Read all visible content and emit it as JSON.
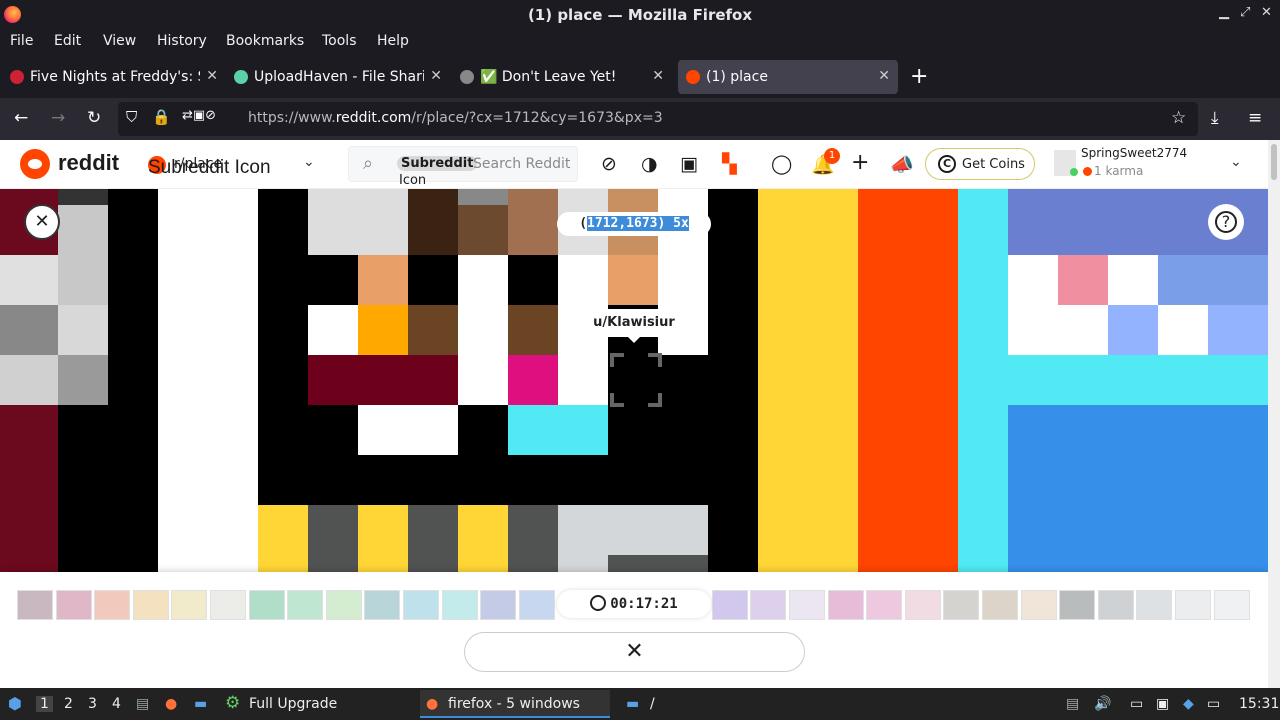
{
  "window": {
    "title": "(1) place — Mozilla Firefox"
  },
  "menu": [
    "File",
    "Edit",
    "View",
    "History",
    "Bookmarks",
    "Tools",
    "Help"
  ],
  "tabs": [
    {
      "label": "Five Nights at Freddy's: S",
      "favicon_color": "#cc2233",
      "active": false
    },
    {
      "label": "UploadHaven - File Shari",
      "favicon_color": "#5cd0a8",
      "active": false
    },
    {
      "label": "✅ Don't Leave Yet!",
      "favicon_color": "#888888",
      "active": false
    },
    {
      "label": "(1) place",
      "favicon_color": "#ff4500",
      "active": true
    }
  ],
  "url": {
    "prefix": "https://www.",
    "domain": "reddit.com",
    "path": "/r/place/?cx=1712&cy=1673&px=3"
  },
  "reddit": {
    "wordmark": "reddit",
    "subreddit": "r/place",
    "subreddit_icon_alt": "Subreddit Icon",
    "search_placeholder": "Search Reddit",
    "search_chip": "Subreddit",
    "search_chip_icon": "Icon",
    "notif_count": "1",
    "coins_label": "Get Coins",
    "username": "SpringSweet2774",
    "karma": "1 karma"
  },
  "place": {
    "coord_text": "(1712,1673) 5x",
    "coord_highlight": "1712,1673) 5x",
    "tooltip_user": "u/Klawisiur",
    "timer": "00:17:21"
  },
  "palette_colors": [
    "#c9b8bf",
    "#dfb7c7",
    "#f1c9bd",
    "#f4e1bf",
    "#f2ebcb",
    "#ecede8",
    "#b0dec9",
    "#bfe6d0",
    "#d4ecd0",
    "#b8d6d9",
    "#bfe1ec",
    "#c4ebec",
    "#c4cbe6",
    "#c7d7ef",
    "#ffffff",
    "#ffffff",
    "#ffffff",
    "#ffffff",
    "#d2c7ec",
    "#ddd0ec",
    "#ebe6f2",
    "#e6bcd8",
    "#eec8de",
    "#f0dce2",
    "#d5d3d0",
    "#ddd4c9",
    "#f0e5d8",
    "#b9bcbd",
    "#cfd2d4",
    "#dde1e4",
    "#ebedef",
    "#f0f1f3"
  ],
  "taskbar": {
    "workspaces": [
      "1",
      "2",
      "3",
      "4"
    ],
    "upgrade_label": "Full Upgrade",
    "firefox_label": "firefox - 5 windows",
    "folder_label": "/",
    "clock": "15:31"
  }
}
